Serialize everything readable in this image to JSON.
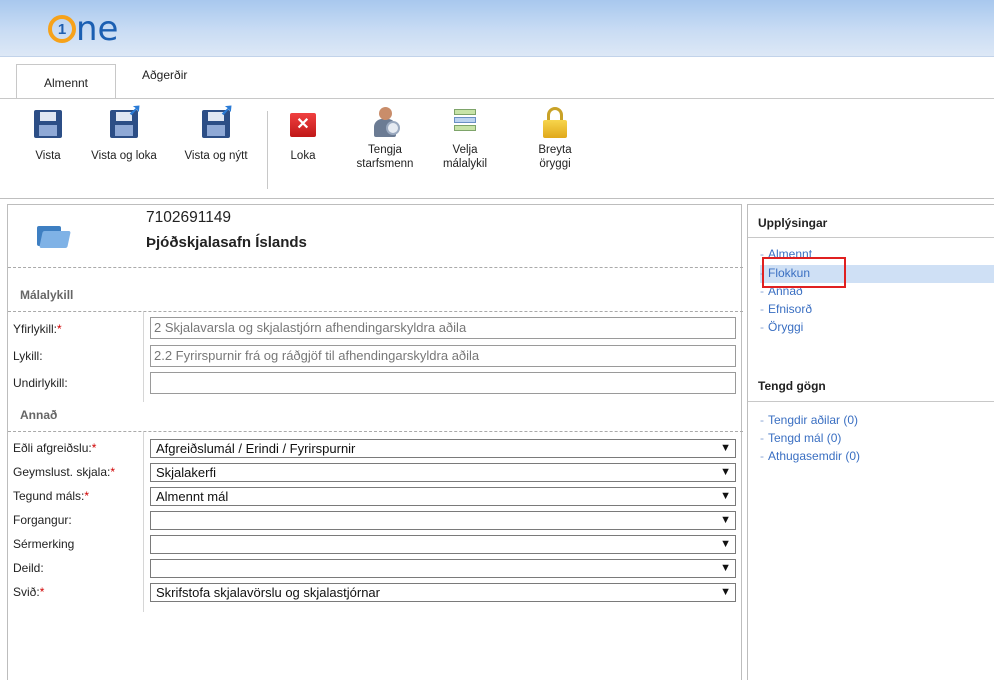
{
  "app": {
    "logo_mark": "1",
    "logo_text": "ne"
  },
  "tabs": [
    {
      "label": "Almennt",
      "active": true
    },
    {
      "label": "Aðgerðir",
      "active": false
    }
  ],
  "ribbon": {
    "save": "Vista",
    "save_close": "Vista og loka",
    "save_new": "Vista og nýtt",
    "close": "Loka",
    "link_staff": [
      "Tengja",
      "starfsmenn"
    ],
    "choose_key": [
      "Velja",
      "málalykil"
    ],
    "change_security": [
      "Breyta",
      "öryggi"
    ]
  },
  "record": {
    "id": "7102691149",
    "name": "Þjóðskjalasafn Íslands"
  },
  "malalykill": {
    "title": "Málalykill",
    "fields": [
      {
        "label": "Yfirlykill:",
        "required": "*",
        "value": "2 Skjalavarsla og skjalastjórn afhendingarskyldra aðila"
      },
      {
        "label": "Lykill:",
        "required": "",
        "value": "2.2 Fyrirspurnir frá og ráðgjöf til afhendingarskyldra aðila"
      },
      {
        "label": "Undirlykill:",
        "required": "",
        "value": ""
      }
    ]
  },
  "annad": {
    "title": "Annað",
    "fields": [
      {
        "label": "Eðli afgreiðslu:",
        "required": "*",
        "value": "Afgreiðslumál / Erindi / Fyrirspurnir"
      },
      {
        "label": "Geymslust. skjala:",
        "required": "*",
        "value": "Skjalakerfi"
      },
      {
        "label": "Tegund máls:",
        "required": "*",
        "value": "Almennt mál"
      },
      {
        "label": "Forgangur:",
        "required": "",
        "value": ""
      },
      {
        "label": "Sérmerking",
        "required": "",
        "value": ""
      },
      {
        "label": "Deild:",
        "required": "",
        "value": ""
      },
      {
        "label": "Svið:",
        "required": "*",
        "value": "Skrifstofa skjalavörslu og skjalastjórnar"
      }
    ]
  },
  "sidebar": {
    "info_title": "Upplýsingar",
    "info_links": [
      "Almennt",
      "Flokkun",
      "Annað",
      "Efnisorð",
      "Öryggi"
    ],
    "related_title": "Tengd gögn",
    "related_links": [
      "Tengdir aðilar (0)",
      "Tengd mál (0)",
      "Athugasemdir (0)"
    ]
  },
  "icons": {
    "save": "save-icon",
    "save_close": "save-close-icon",
    "save_new": "save-new-icon",
    "close": "close-icon",
    "staff": "link-staff-icon",
    "key": "list-icon",
    "security": "lock-icon",
    "record": "folder-icon",
    "dropdown": "chevron-down-icon"
  },
  "colors": {
    "header_blue": "#a8c8ee",
    "link_blue": "#3a6fc2",
    "required_red": "#d00000",
    "selected_row": "#cfe0f5",
    "highlight_red": "#e02020"
  }
}
